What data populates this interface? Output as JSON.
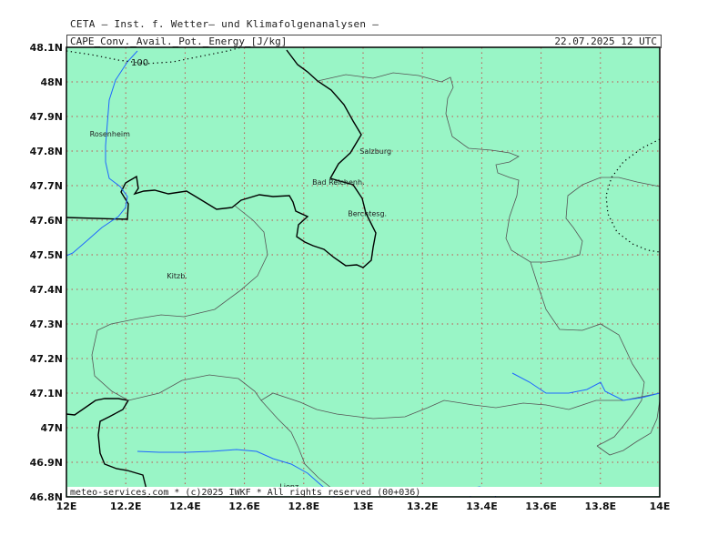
{
  "header": {
    "institute": "CETA — Inst. f. Wetter— und Klimafolgenanalysen —",
    "variable": "CAPE_Conv._Avail._Pot._Energy_[J/kg]",
    "valid_time": "22.07.2025  12 UTC"
  },
  "map": {
    "background_color": "#99f5c6",
    "lon_range": [
      12.0,
      14.0
    ],
    "lat_range": [
      46.8,
      48.1
    ],
    "lat_labels": [
      "48.1N",
      "48N",
      "47.9N",
      "47.8N",
      "47.7N",
      "47.6N",
      "47.5N",
      "47.4N",
      "47.3N",
      "47.2N",
      "47.1N",
      "47N",
      "46.9N",
      "46.8N"
    ],
    "lon_labels": [
      "12E",
      "12.2E",
      "12.4E",
      "12.6E",
      "12.8E",
      "13E",
      "13.2E",
      "13.4E",
      "13.6E",
      "13.8E",
      "14E"
    ],
    "contour_label": "100",
    "cities": [
      {
        "name": "Rosenheim",
        "lon": 12.14,
        "lat": 47.85
      },
      {
        "name": "Salzburg",
        "lon": 13.05,
        "lat": 47.8
      },
      {
        "name": "Bad Reichenh.",
        "lon": 12.89,
        "lat": 47.71
      },
      {
        "name": "Berchtesg.",
        "lon": 13.01,
        "lat": 47.62
      },
      {
        "name": "Kitzb.",
        "lon": 12.4,
        "lat": 47.44
      },
      {
        "name": "Lienz",
        "lon": 12.78,
        "lat": 46.83
      }
    ]
  },
  "footer": {
    "credit": "meteo-services.com * (c)2025 IWKF * All rights reserved (00+036)"
  }
}
